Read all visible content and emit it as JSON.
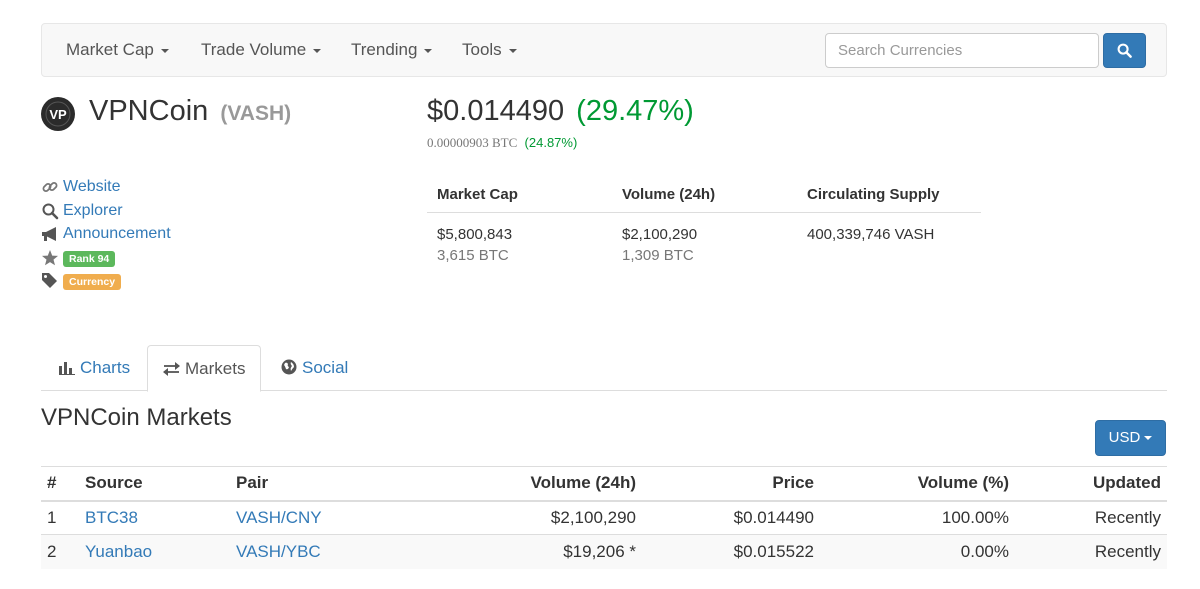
{
  "navbar": {
    "items": [
      "Market Cap",
      "Trade Volume",
      "Trending",
      "Tools"
    ],
    "search_placeholder": "Search Currencies"
  },
  "coin": {
    "name": "VPNCoin",
    "symbol": "(VASH)",
    "logo_text": "VP",
    "price_usd": "$0.014490",
    "change_usd": "(29.47%)",
    "price_btc": "0.00000903 BTC",
    "change_btc": "(24.87%)"
  },
  "links": {
    "website": "Website",
    "explorer": "Explorer",
    "announcement": "Announcement",
    "rank": "Rank 94",
    "category": "Currency"
  },
  "stats": {
    "headers": [
      "Market Cap",
      "Volume (24h)",
      "Circulating Supply"
    ],
    "market_cap_usd": "$5,800,843",
    "market_cap_btc": "3,615 BTC",
    "volume_usd": "$2,100,290",
    "volume_btc": "1,309 BTC",
    "supply": "400,339,746 VASH"
  },
  "tabs": [
    "Charts",
    "Markets",
    "Social"
  ],
  "markets": {
    "title": "VPNCoin Markets",
    "currency_button": "USD",
    "columns": [
      "#",
      "Source",
      "Pair",
      "Volume (24h)",
      "Price",
      "Volume (%)",
      "Updated"
    ],
    "rows": [
      [
        "1",
        "BTC38",
        "VASH/CNY",
        "$2,100,290",
        "$0.014490",
        "100.00%",
        "Recently"
      ],
      [
        "2",
        "Yuanbao",
        "VASH/YBC",
        "$19,206 *",
        "$0.015522",
        "0.00%",
        "Recently"
      ]
    ]
  },
  "colors": {
    "accent": "#337ab7",
    "positive": "#009933",
    "rank_label": "#5cb85c",
    "category_label": "#f0ad4e"
  }
}
